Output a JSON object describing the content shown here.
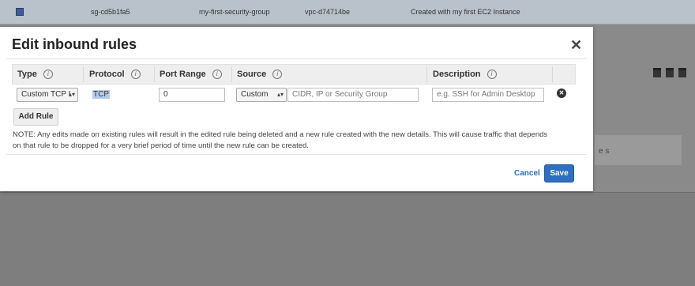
{
  "background": {
    "row": {
      "group_id": "sg-cd5b1fa5",
      "group_name": "my-first-security-group",
      "vpc_id": "vpc-d74714be",
      "description": "Created with my first EC2 Instance"
    },
    "side_text": "e s"
  },
  "modal": {
    "title": "Edit inbound rules",
    "close_glyph": "✕",
    "columns": {
      "type": "Type",
      "protocol": "Protocol",
      "port_range": "Port Range",
      "source": "Source",
      "description": "Description"
    },
    "info_glyph": "i",
    "rule": {
      "type": "Custom TCP I",
      "protocol": "TCP",
      "port_range": "0",
      "source_type": "Custom",
      "source_placeholder": "CIDR, IP or Security Group",
      "description_placeholder": "e.g. SSH for Admin Desktop"
    },
    "add_rule_label": "Add Rule",
    "note_line1": "NOTE: Any edits made on existing rules will result in the edited rule being deleted and a new rule created with the new details. This will cause traffic that depends",
    "note_line2": "on that rule to be dropped for a very brief period of time until the new rule can be created.",
    "cancel_label": "Cancel",
    "save_label": "Save"
  }
}
